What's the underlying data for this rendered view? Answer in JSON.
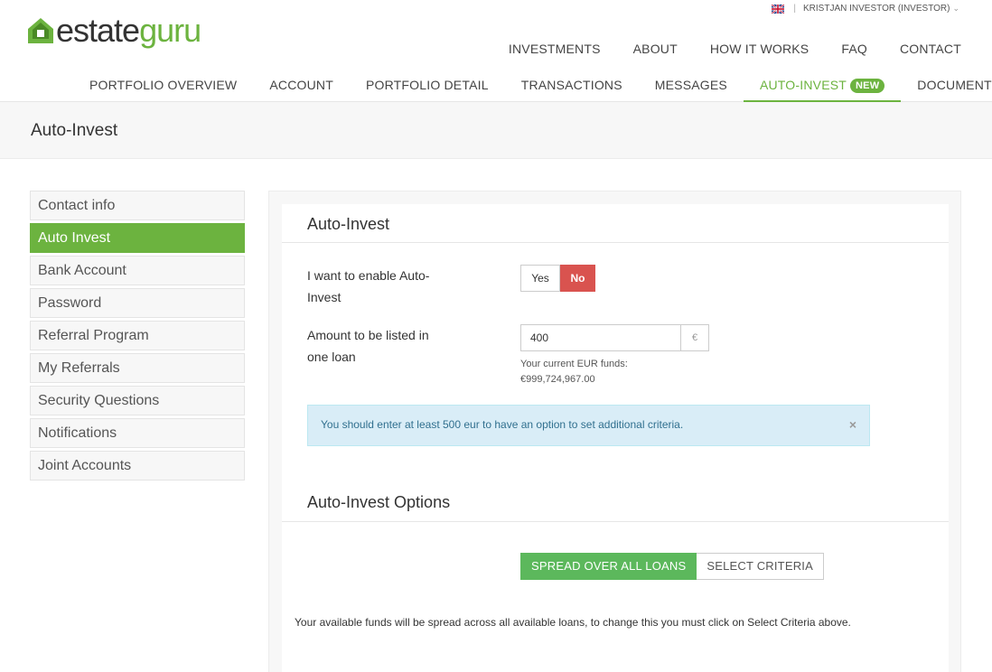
{
  "brand": {
    "logo_estate": "estate",
    "logo_guru": "guru",
    "accent": "#6cb33f"
  },
  "userbar": {
    "flag_icon": "uk-flag-icon",
    "user_label": "KRISTJAN INVESTOR (INVESTOR)"
  },
  "topnav": [
    "INVESTMENTS",
    "ABOUT",
    "HOW IT WORKS",
    "FAQ",
    "CONTACT"
  ],
  "subnav": {
    "items": [
      "PORTFOLIO OVERVIEW",
      "ACCOUNT",
      "PORTFOLIO DETAIL",
      "TRANSACTIONS",
      "MESSAGES",
      "AUTO-INVEST",
      "DOCUMENTS"
    ],
    "active": "AUTO-INVEST",
    "new_badge": "NEW"
  },
  "page_title": "Auto-Invest",
  "sidebar": {
    "items": [
      "Contact info",
      "Auto Invest",
      "Bank Account",
      "Password",
      "Referral Program",
      "My Referrals",
      "Security Questions",
      "Notifications",
      "Joint Accounts"
    ],
    "active": "Auto Invest"
  },
  "autoinvest": {
    "title": "Auto-Invest",
    "enable_label_line1": "I want to enable Auto-",
    "enable_label_line2": "Invest",
    "yes_label": "Yes",
    "no_label": "No",
    "selected": "No",
    "amount_label_line1": "Amount to be listed in",
    "amount_label_line2": "one loan",
    "amount_value": "400",
    "currency_addon": "€",
    "funds_label": "Your current EUR funds:",
    "funds_value": "€999,724,967.00",
    "alert_text": "You should enter at least 500 eur to have an option to set additional criteria.",
    "alert_close": "×"
  },
  "options": {
    "title": "Auto-Invest Options",
    "spread_label": "SPREAD OVER ALL LOANS",
    "criteria_label": "SELECT CRITERIA",
    "selected": "SPREAD OVER ALL LOANS",
    "note": "Your available funds will be spread across all available loans, to change this you must click on Select Criteria above."
  }
}
